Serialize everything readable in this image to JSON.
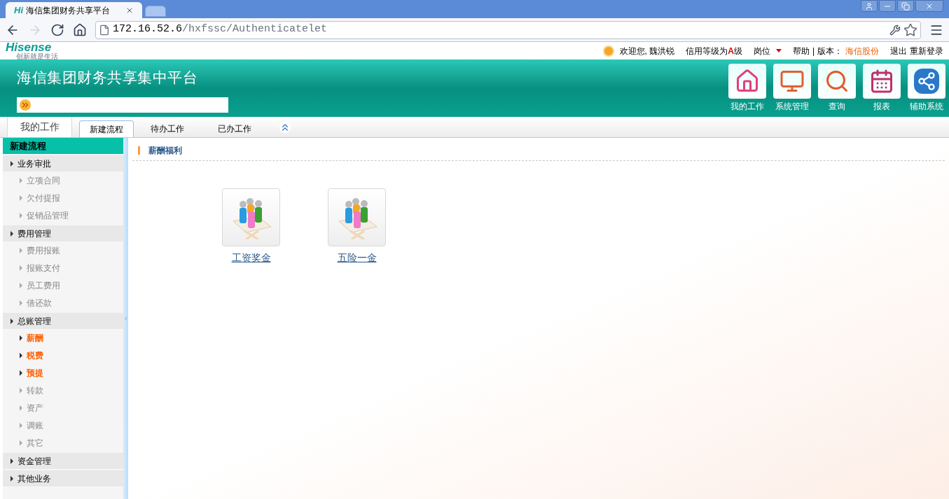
{
  "browser": {
    "tab_title": "海信集团财务共享平台",
    "tab_logo": "Hi",
    "url_host": "172.16.52.6",
    "url_path": "/hxfssc/Authenticatelet"
  },
  "header": {
    "logo_text": "Hisense",
    "logo_tagline": "创新就是生活",
    "welcome": "欢迎您, 魏洪锐",
    "credit_prefix": "信用等级为",
    "credit_grade": "A",
    "credit_suffix": "级",
    "post": "岗位",
    "help": "帮助",
    "separator": "|",
    "version_label": "版本：",
    "version_value": "海信股份",
    "logout": "退出",
    "relogin": "重新登录"
  },
  "banner": {
    "title": "海信集团财务共享集中平台",
    "nav_buttons": [
      {
        "label": "我的工作",
        "kind": "home"
      },
      {
        "label": "系统管理",
        "kind": "system"
      },
      {
        "label": "查询",
        "kind": "search"
      },
      {
        "label": "报表",
        "kind": "report"
      },
      {
        "label": "辅助系统",
        "kind": "share"
      }
    ]
  },
  "tab_bar": {
    "title": "我的工作",
    "tabs": [
      {
        "label": "新建流程",
        "selected": true
      },
      {
        "label": "待办工作",
        "selected": false
      },
      {
        "label": "已办工作",
        "selected": false
      }
    ]
  },
  "sidebar": {
    "heading": "新建流程",
    "groups": [
      {
        "label": "业务审批",
        "children": [
          {
            "label": "立项合同",
            "selected": false
          },
          {
            "label": "欠付提报",
            "selected": false
          },
          {
            "label": "促销品管理",
            "selected": false
          }
        ]
      },
      {
        "label": "费用管理",
        "children": [
          {
            "label": "费用报账",
            "selected": false
          },
          {
            "label": "报账支付",
            "selected": false
          },
          {
            "label": "员工费用",
            "selected": false
          },
          {
            "label": "借还款",
            "selected": false
          }
        ]
      },
      {
        "label": "总账管理",
        "children": [
          {
            "label": "薪酬",
            "selected": true
          },
          {
            "label": "税费",
            "selected": true
          },
          {
            "label": "预提",
            "selected": true
          },
          {
            "label": "转款",
            "selected": false
          },
          {
            "label": "资产",
            "selected": false
          },
          {
            "label": "调账",
            "selected": false
          },
          {
            "label": "其它",
            "selected": false
          }
        ]
      },
      {
        "label": "资金管理"
      },
      {
        "label": "其他业务"
      }
    ]
  },
  "content": {
    "section_title": "薪酬福利",
    "tiles": [
      {
        "label": "工资奖金"
      },
      {
        "label": "五险一金"
      }
    ]
  }
}
